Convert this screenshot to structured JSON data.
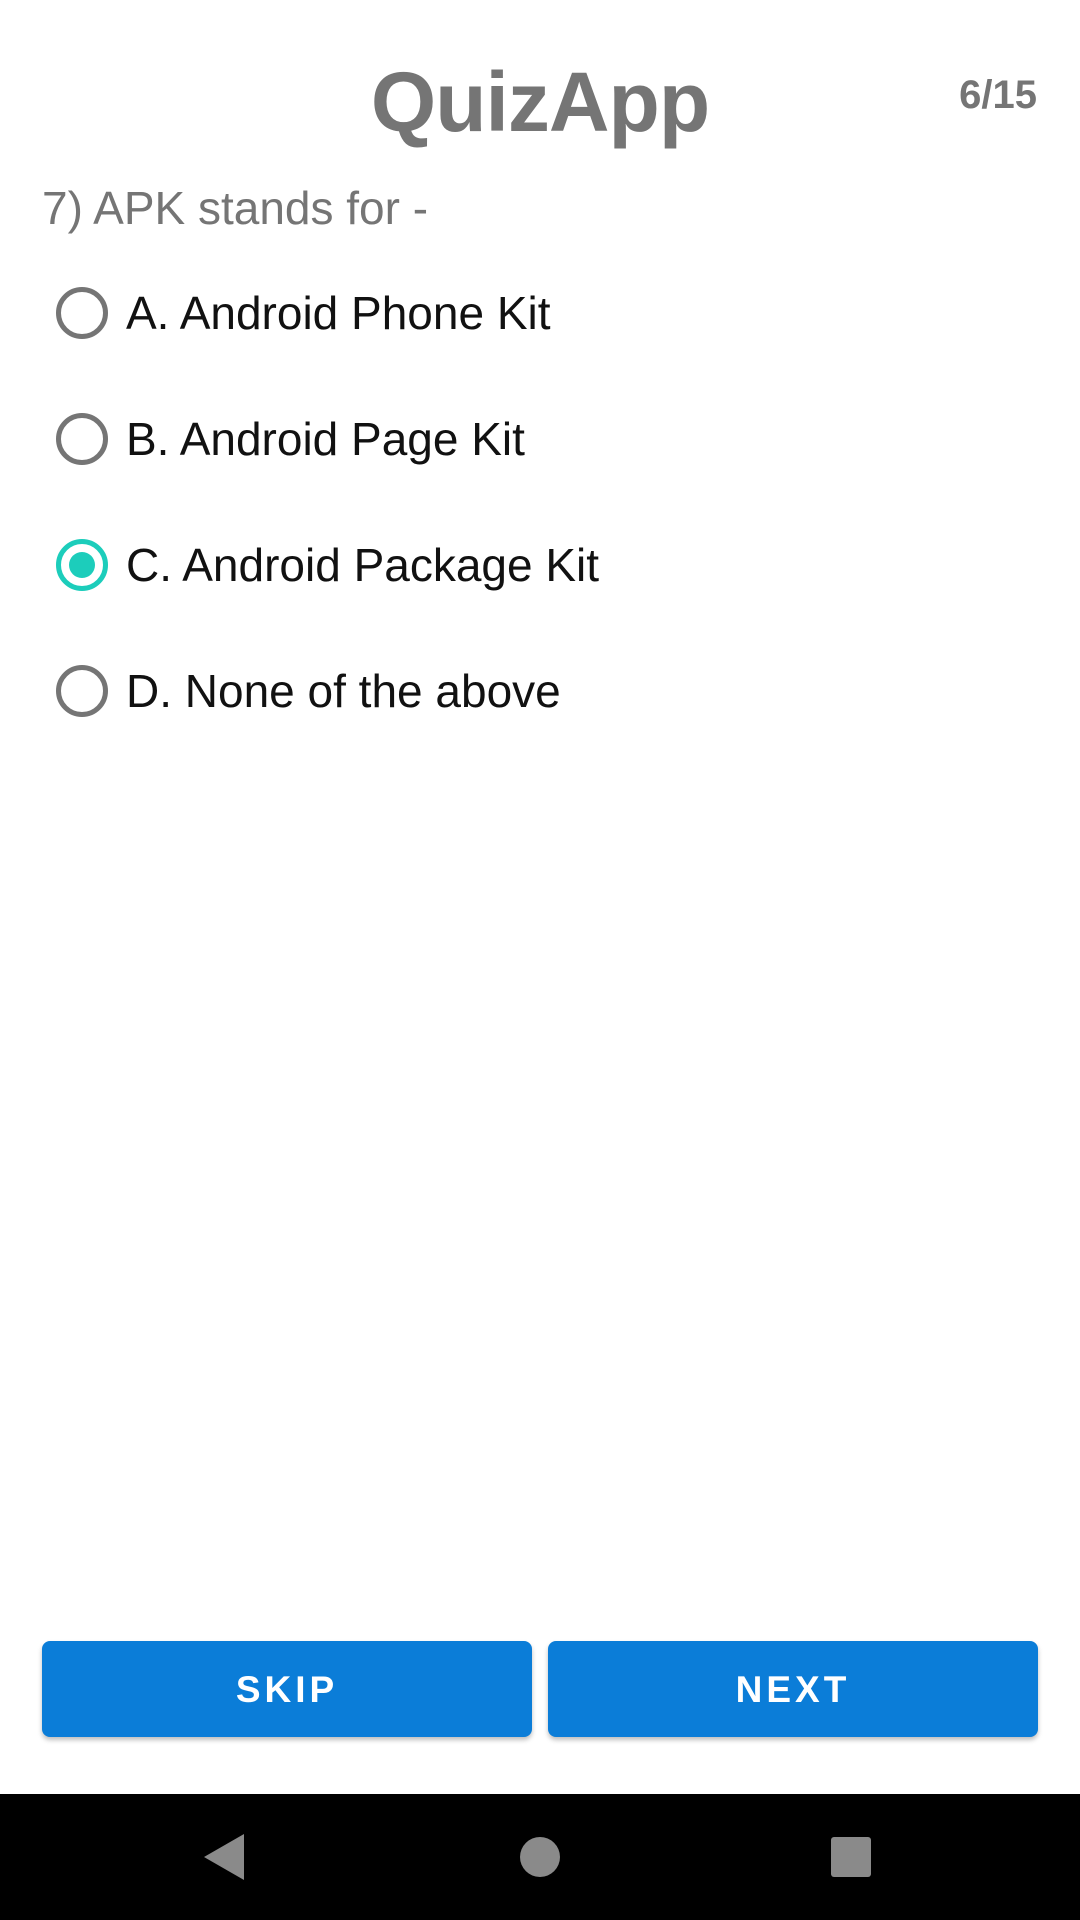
{
  "header": {
    "title": "QuizApp",
    "progress": "6/15"
  },
  "question": {
    "text": "7) APK stands for -"
  },
  "options": [
    {
      "label": "A. Android Phone Kit",
      "selected": false
    },
    {
      "label": "B. Android Page Kit",
      "selected": false
    },
    {
      "label": "C. Android Package Kit",
      "selected": true
    },
    {
      "label": "D. None of the above",
      "selected": false
    }
  ],
  "buttons": {
    "skip_label": "SKIP",
    "next_label": "NEXT"
  },
  "colors": {
    "accent": "#1ccdbb",
    "button": "#0b7dd8",
    "title": "#757575"
  },
  "navbar": {
    "back_icon": "back-triangle-icon",
    "home_icon": "home-circle-icon",
    "recents_icon": "recents-square-icon"
  }
}
